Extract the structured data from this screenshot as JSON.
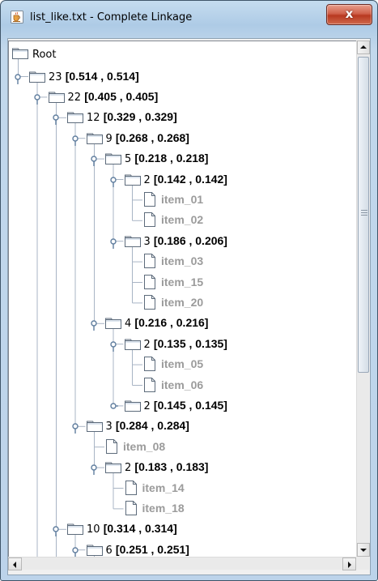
{
  "window": {
    "title": "list_like.txt - Complete Linkage",
    "close_label": "x"
  },
  "tree": {
    "root_label": "Root",
    "nodes": [
      {
        "depth": 0,
        "type": "folder",
        "count": "23",
        "range": "[0.514 , 0.514]",
        "expanded": true
      },
      {
        "depth": 1,
        "type": "folder",
        "count": "22",
        "range": "[0.405 , 0.405]",
        "expanded": true
      },
      {
        "depth": 2,
        "type": "folder",
        "count": "12",
        "range": "[0.329 , 0.329]",
        "expanded": true
      },
      {
        "depth": 3,
        "type": "folder",
        "count": "9",
        "range": "[0.268 , 0.268]",
        "expanded": true
      },
      {
        "depth": 4,
        "type": "folder",
        "count": "5",
        "range": "[0.218 , 0.218]",
        "expanded": true
      },
      {
        "depth": 5,
        "type": "folder",
        "count": "2",
        "range": "[0.142 , 0.142]",
        "expanded": true
      },
      {
        "depth": 6,
        "type": "leaf",
        "label": "item_01"
      },
      {
        "depth": 6,
        "type": "leaf",
        "label": "item_02"
      },
      {
        "depth": 5,
        "type": "folder",
        "count": "3",
        "range": "[0.186 , 0.206]",
        "expanded": true
      },
      {
        "depth": 6,
        "type": "leaf",
        "label": "item_03"
      },
      {
        "depth": 6,
        "type": "leaf",
        "label": "item_15"
      },
      {
        "depth": 6,
        "type": "leaf",
        "label": "item_20"
      },
      {
        "depth": 4,
        "type": "folder",
        "count": "4",
        "range": "[0.216 , 0.216]",
        "expanded": true
      },
      {
        "depth": 5,
        "type": "folder",
        "count": "2",
        "range": "[0.135 , 0.135]",
        "expanded": true
      },
      {
        "depth": 6,
        "type": "leaf",
        "label": "item_05"
      },
      {
        "depth": 6,
        "type": "leaf",
        "label": "item_06"
      },
      {
        "depth": 5,
        "type": "folder",
        "count": "2",
        "range": "[0.145 , 0.145]",
        "expanded": false
      },
      {
        "depth": 3,
        "type": "folder",
        "count": "3",
        "range": "[0.284 , 0.284]",
        "expanded": true
      },
      {
        "depth": 4,
        "type": "leaf",
        "label": "item_08"
      },
      {
        "depth": 4,
        "type": "folder",
        "count": "2",
        "range": "[0.183 , 0.183]",
        "expanded": true
      },
      {
        "depth": 5,
        "type": "leaf",
        "label": "item_14"
      },
      {
        "depth": 5,
        "type": "leaf",
        "label": "item_18"
      },
      {
        "depth": 2,
        "type": "folder",
        "count": "10",
        "range": "[0.314 , 0.314]",
        "expanded": true
      },
      {
        "depth": 3,
        "type": "folder",
        "count": "6",
        "range": "[0.251 , 0.251]",
        "expanded": true
      }
    ]
  },
  "colors": {
    "leaf_text": "#9b9b9b",
    "tree_line": "#a8b4c4",
    "handle": "#5f7d9e"
  },
  "icons": {
    "app": "java-cup-icon",
    "folder": "folder-icon",
    "leaf": "document-icon",
    "expand_handle": "expanded-handle-icon",
    "collapse_handle": "collapsed-handle-icon"
  }
}
